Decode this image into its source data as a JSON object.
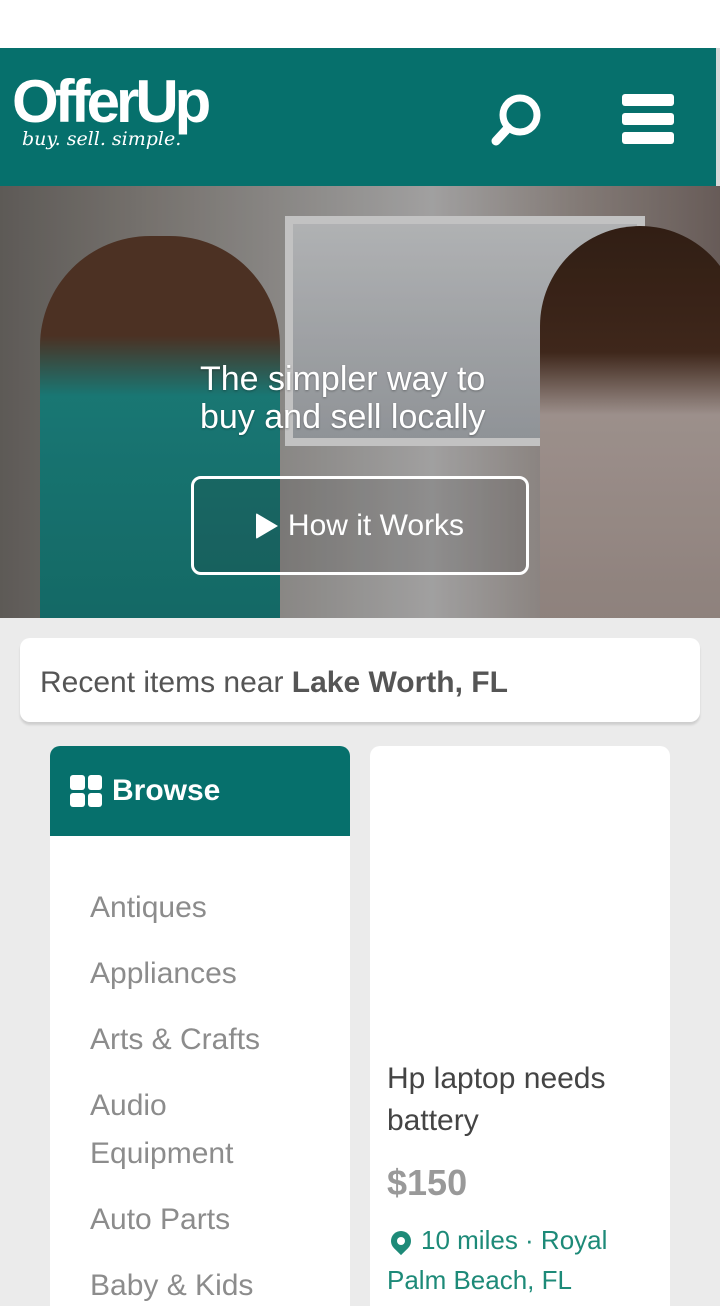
{
  "header": {
    "logo": "OfferUp",
    "tagline": "buy. sell. simple.",
    "brand_color": "#06706c",
    "search_icon": "search-icon",
    "menu_icon": "hamburger-icon"
  },
  "hero": {
    "title_line1": "The simpler way to",
    "title_line2": "buy and sell locally",
    "button_label": "How it Works"
  },
  "recent": {
    "prefix": "Recent items near ",
    "location": "Lake Worth, FL"
  },
  "browse": {
    "title": "Browse",
    "categories": [
      "Antiques",
      "Appliances",
      "Arts & Crafts",
      "Audio Equipment",
      "Auto Parts",
      "Baby & Kids"
    ]
  },
  "listing": {
    "title": "Hp laptop needs battery",
    "price": "$150",
    "location": "10 miles · Royal Palm Beach, FL"
  }
}
